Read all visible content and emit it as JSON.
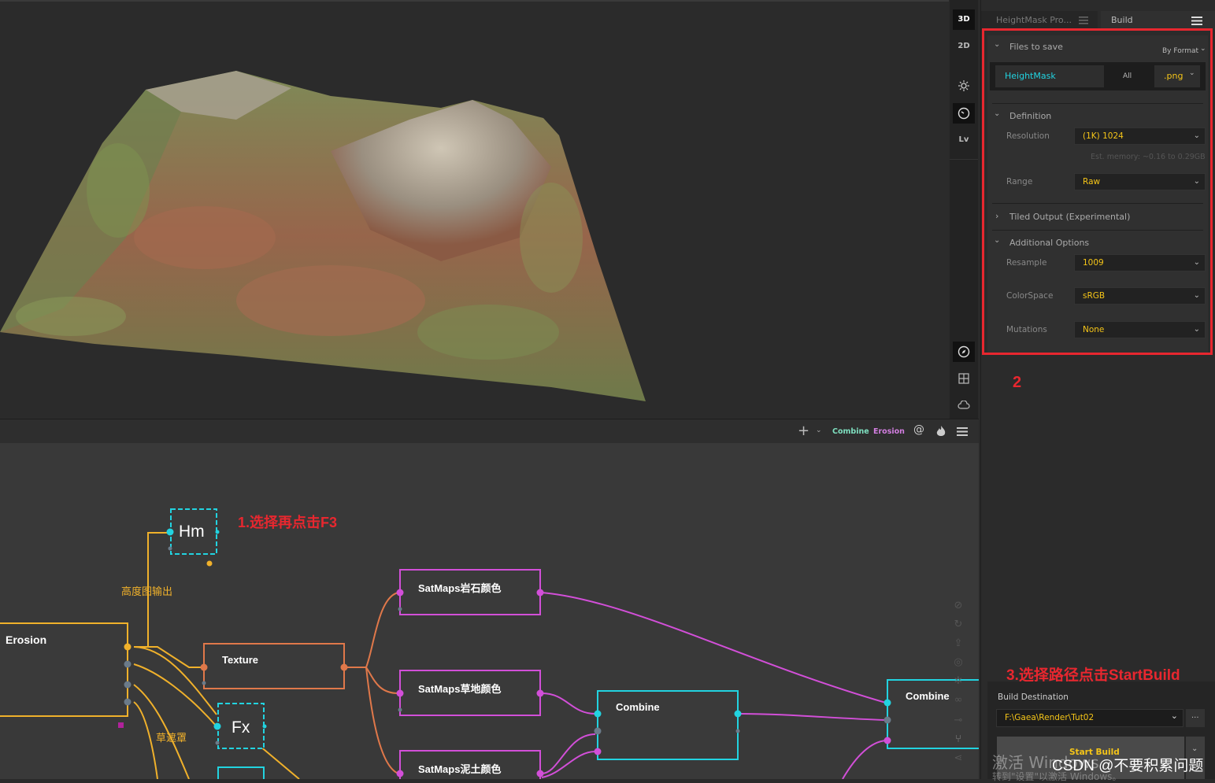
{
  "viewport_toolbar": {
    "btn_3d": "3D",
    "btn_2d": "2D",
    "btn_lv": "Lv"
  },
  "graph_toolbar": {
    "combine_chip": "Combine",
    "erosion_chip": "Erosion"
  },
  "nodes": {
    "hm": "Hm",
    "erosion": "Erosion",
    "texture": "Texture",
    "fx": "Fx",
    "satmaps_rock": "SatMaps岩石颜色",
    "satmaps_grass": "SatMaps草地颜色",
    "satmaps_soil": "SatMaps泥土颜色",
    "combine1": "Combine",
    "combine2": "Combine"
  },
  "connection_labels": {
    "height_output": "高度图输出",
    "grass_mask": "草遮罩"
  },
  "annotations": {
    "step1": "1.选择再点击F3",
    "step2": "2",
    "step3": "3.选择路径点击StartBuild"
  },
  "right_panel": {
    "tab_heightmask": "HeightMask Pro...",
    "tab_build": "Build",
    "files_to_save": "Files to save",
    "by_format": "By Format",
    "file_name": "HeightMask",
    "file_all": "All",
    "file_format": ".png",
    "definition": "Definition",
    "resolution_label": "Resolution",
    "resolution_value": "(1K) 1024",
    "est_memory": "Est. memory: ~0.16 to 0.29GB",
    "range_label": "Range",
    "range_value": "Raw",
    "tiled_output": "Tiled Output (Experimental)",
    "additional_options": "Additional Options",
    "resample_label": "Resample",
    "resample_value": "1009",
    "colorspace_label": "ColorSpace",
    "colorspace_value": "sRGB",
    "mutations_label": "Mutations",
    "mutations_value": "None",
    "build_destination": "Build Destination",
    "destination_path": "F:\\Gaea\\Render\\Tut02",
    "browse": "...",
    "start_build": "Start Build"
  },
  "watermark": {
    "activate": "激活 Windows",
    "activate_sub": "转到\"设置\"以激活 Windows。",
    "csdn": "CSDN @不要积累问题"
  },
  "colors": {
    "accent_cyan": "#22d3e0",
    "accent_magenta": "#d24fd8",
    "accent_yellow": "#f0b12b",
    "accent_orange": "#e0784a",
    "annotation_red": "#e8272f"
  }
}
